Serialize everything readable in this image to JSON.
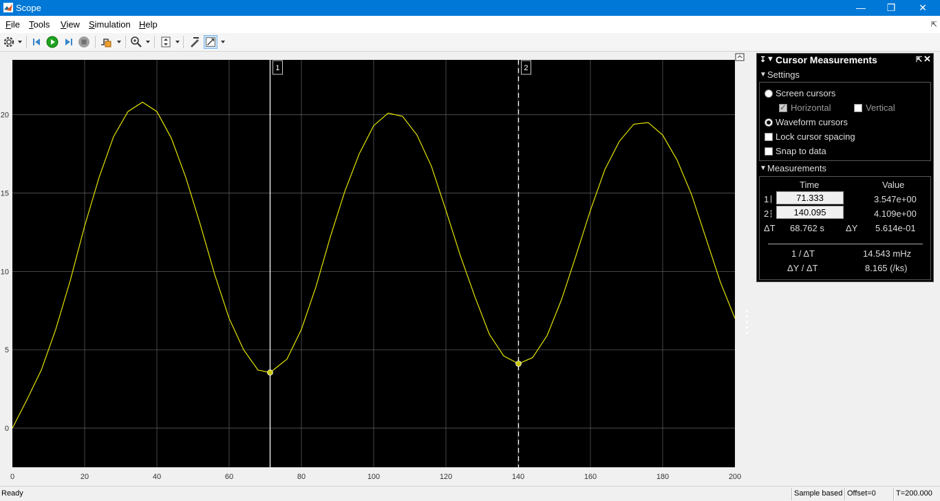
{
  "window": {
    "title": "Scope"
  },
  "menu": [
    {
      "label": "File",
      "u": "F",
      "rest": "ile"
    },
    {
      "label": "Tools",
      "u": "T",
      "rest": "ools"
    },
    {
      "label": "View",
      "u": "V",
      "rest": "iew"
    },
    {
      "label": "Simulation",
      "u": "S",
      "rest": "imulation"
    },
    {
      "label": "Help",
      "u": "H",
      "rest": "elp"
    }
  ],
  "toolbar_icons": [
    "gear-icon",
    "step-back-icon",
    "run-icon",
    "step-forward-icon",
    "stop-icon",
    "trigger-icon",
    "zoom-icon",
    "autoscale-icon",
    "highlight-icon",
    "cursor-measurements-icon"
  ],
  "colors": {
    "titlebar": "#0078d7",
    "signal": "#e6e600",
    "plot_bg": "#000000",
    "grid": "#5a5a5a",
    "cursor_marker": "#c8c800"
  },
  "chart_data": {
    "type": "line",
    "xlim": [
      0,
      200
    ],
    "ylim": [
      -2.5,
      23.5
    ],
    "xticks": [
      0,
      20,
      40,
      60,
      80,
      100,
      120,
      140,
      160,
      180,
      200
    ],
    "yticks": [
      0,
      5,
      10,
      15,
      20
    ],
    "grid": true,
    "series": [
      {
        "x": [
          0,
          4,
          8,
          12,
          16,
          20,
          24,
          28,
          32,
          36,
          40,
          44,
          48,
          52,
          56,
          60,
          64,
          68,
          71.333,
          76,
          80,
          84,
          88,
          92,
          96,
          100,
          104,
          108,
          112,
          116,
          120,
          124,
          128,
          132,
          136,
          140.095,
          144,
          148,
          152,
          156,
          160,
          164,
          168,
          172,
          176,
          180,
          184,
          188,
          192,
          196,
          200
        ],
        "y": [
          0,
          1.8,
          3.7,
          6.3,
          9.4,
          12.9,
          16.0,
          18.6,
          20.2,
          20.8,
          20.2,
          18.5,
          16.0,
          13.0,
          9.8,
          7.0,
          5.0,
          3.7,
          3.547,
          4.4,
          6.3,
          9.0,
          12.2,
          15.1,
          17.5,
          19.3,
          20.1,
          19.9,
          18.7,
          16.7,
          13.9,
          11.0,
          8.4,
          6.0,
          4.6,
          4.109,
          4.5,
          5.9,
          8.2,
          11.0,
          13.9,
          16.5,
          18.3,
          19.4,
          19.5,
          18.7,
          17.1,
          14.9,
          12.1,
          9.3,
          7.0
        ]
      }
    ],
    "cursors": [
      {
        "label": "1",
        "x": 71.333,
        "y": 3.547,
        "style": "solid"
      },
      {
        "label": "2",
        "x": 140.095,
        "y": 4.109,
        "style": "dashed"
      }
    ]
  },
  "panel": {
    "title": "Cursor Measurements",
    "settings_title": "Settings",
    "screen_cursors": "Screen cursors",
    "horizontal": "Horizontal",
    "vertical": "Vertical",
    "waveform_cursors": "Waveform cursors",
    "lock_spacing": "Lock cursor spacing",
    "snap": "Snap to data",
    "measurements_title": "Measurements",
    "col_time": "Time",
    "col_value": "Value",
    "row1_label": "1",
    "row1_time": "71.333",
    "row1_value": "3.547e+00",
    "row2_label": "2",
    "row2_time": "140.095",
    "row2_value": "4.109e+00",
    "dt_label": "ΔT",
    "dt_value": "68.762 s",
    "dy_label": "ΔY",
    "dy_value": "5.614e-01",
    "inv_dt_label": "1 / ΔT",
    "inv_dt_value": "14.543 mHz",
    "slope_label": "ΔY / ΔT",
    "slope_value": "8.165 (/ks)"
  },
  "status": {
    "ready": "Ready",
    "mode": "Sample based",
    "offset": "Offset=0",
    "time": "T=200.000"
  }
}
